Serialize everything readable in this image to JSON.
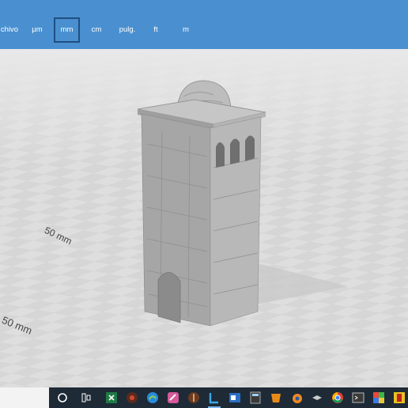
{
  "units": {
    "items": [
      "chivo",
      "µm",
      "mm",
      "cm",
      "pulg.",
      "ft",
      "m"
    ],
    "selected": "mm"
  },
  "viewport": {
    "dim_label_back": "50 mm",
    "dim_label_front": "50 mm"
  },
  "taskbar": {
    "icons": [
      "cortana-circle-icon",
      "task-view-icon",
      "excel-icon",
      "app-red-icon",
      "edge-icon",
      "app-pink-icon",
      "app-brown-icon",
      "3d-viewer-icon",
      "outlook-icon",
      "calculator-icon",
      "app-orange-icon",
      "blender-icon",
      "app-dark-icon",
      "chrome-icon",
      "app-terminal-icon",
      "app-colorful-icon",
      "app-yellow-icon"
    ]
  },
  "colors": {
    "top_bar": "#4a90d0",
    "model": "#a8a8a8",
    "taskbar": "#1e2a36"
  }
}
